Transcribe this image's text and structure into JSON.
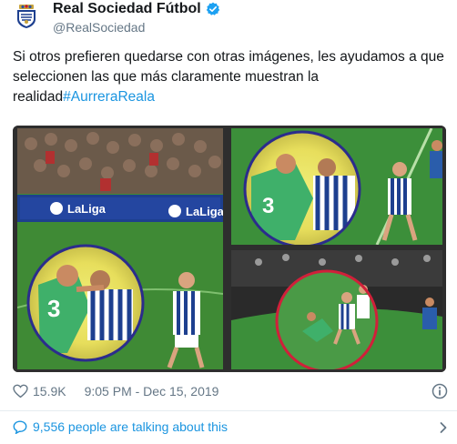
{
  "account": {
    "name": "Real Sociedad Fútbol",
    "handle": "@RealSociedad"
  },
  "tweet": {
    "text": "Si otros prefieren quedarse con otras imágenes, les ayudamos a que seleccionen las que más claramente muestran la realidad",
    "hashtag": "#AurreraReala",
    "media_banner_1": "LaLiga",
    "media_banner_2": "LaLiga",
    "jersey_number": "3"
  },
  "meta": {
    "likes": "15.9K",
    "time": "9:05 PM - Dec 15, 2019"
  },
  "footer": {
    "talking": "9,556 people are talking about this"
  },
  "colors": {
    "link": "#1b95e0",
    "muted": "#657786",
    "pitch": "#3f8a35",
    "highlight": "#e7e06a",
    "circle_blue": "#2b2c8c",
    "circle_red": "#d0203a"
  }
}
